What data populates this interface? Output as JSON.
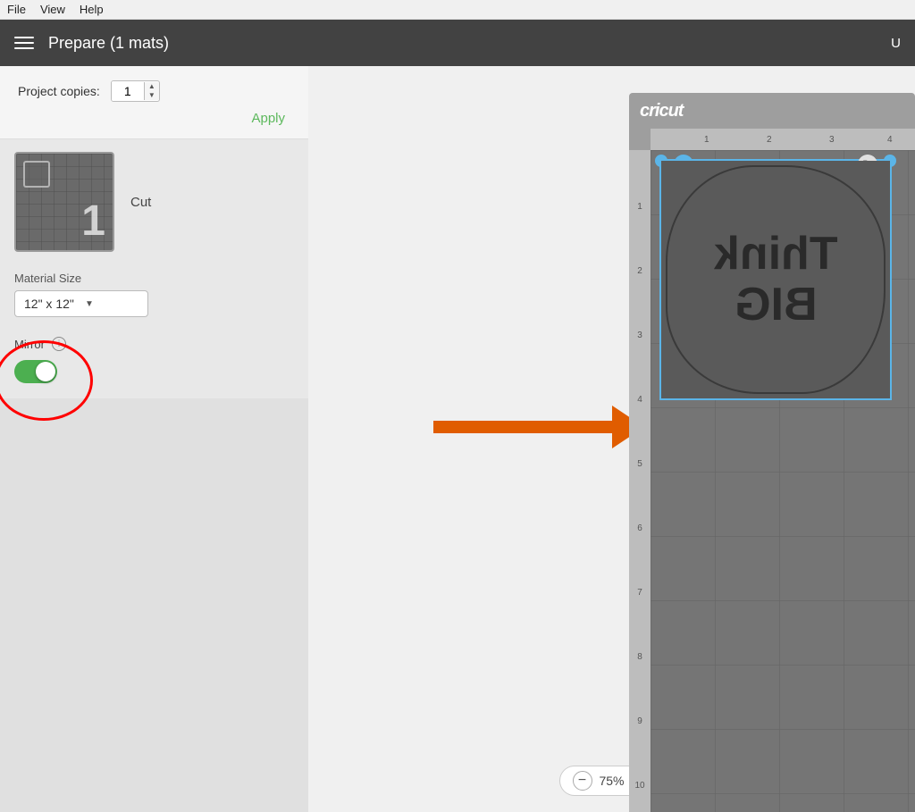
{
  "menubar": {
    "items": [
      "File",
      "View",
      "Help"
    ]
  },
  "header": {
    "title": "Prepare (1 mats)",
    "hamburger_label": "menu",
    "right_label": "U"
  },
  "sidebar": {
    "copies_label": "Project copies:",
    "copies_value": "1",
    "apply_label": "Apply",
    "mat_number": "1",
    "mat_action": "Cut",
    "material_size_label": "Material Size",
    "material_size_value": "12\" x 12\"",
    "mirror_label": "Mirror",
    "mirror_enabled": true,
    "mirror_info": "i"
  },
  "zoom": {
    "level": "75%",
    "minus": "−",
    "plus": "+"
  },
  "mat": {
    "brand": "cricut",
    "ruler_ticks": [
      "1",
      "2",
      "3",
      "4"
    ],
    "left_ruler_nums": [
      "1",
      "2",
      "3",
      "4",
      "5",
      "6",
      "7",
      "8",
      "9",
      "10"
    ],
    "design_text_line1": "Think",
    "design_text_line2": "BIG"
  },
  "arrow": {
    "color": "#e05c00"
  },
  "annotation": {
    "circle_color": "red"
  }
}
